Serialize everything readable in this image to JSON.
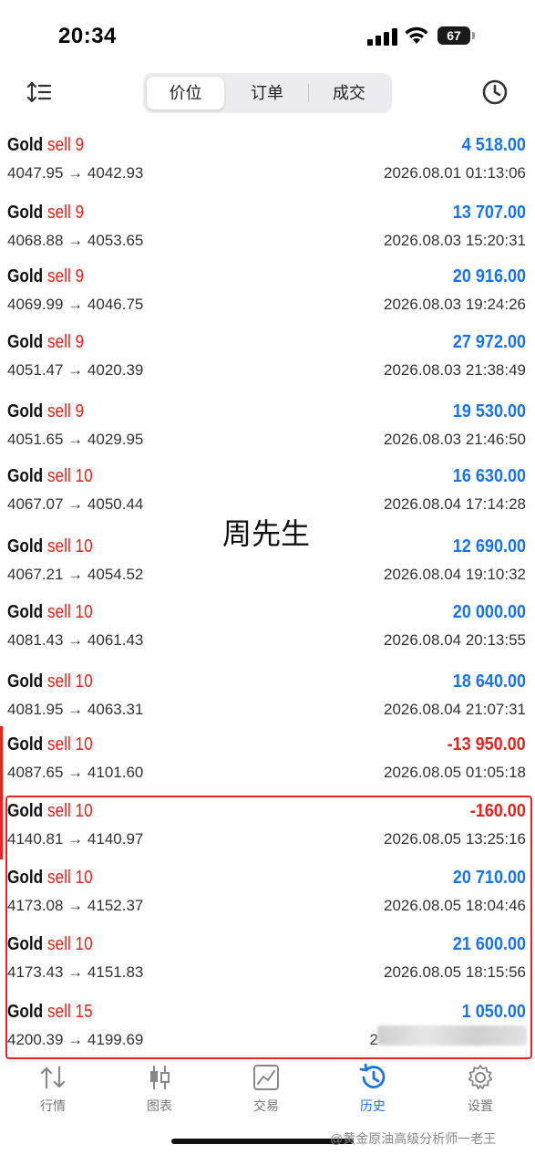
{
  "status_bar": {
    "time": "20:34",
    "battery": "67"
  },
  "toolbar": {
    "tabs": [
      {
        "label": "价位",
        "active": true
      },
      {
        "label": "订单",
        "active": false
      },
      {
        "label": "成交",
        "active": false
      }
    ]
  },
  "trades": [
    {
      "symbol": "Gold",
      "side": "sell",
      "volume": "9",
      "open": "4047.95",
      "close": "4042.93",
      "profit": "4 518.00",
      "time": "2026.08.01 01:13:06"
    },
    {
      "symbol": "Gold",
      "side": "sell",
      "volume": "9",
      "open": "4068.88",
      "close": "4053.65",
      "profit": "13 707.00",
      "time": "2026.08.03 15:20:31"
    },
    {
      "symbol": "Gold",
      "side": "sell",
      "volume": "9",
      "open": "4069.99",
      "close": "4046.75",
      "profit": "20 916.00",
      "time": "2026.08.03 19:24:26"
    },
    {
      "symbol": "Gold",
      "side": "sell",
      "volume": "9",
      "open": "4051.47",
      "close": "4020.39",
      "profit": "27 972.00",
      "time": "2026.08.03 21:38:49"
    },
    {
      "symbol": "Gold",
      "side": "sell",
      "volume": "9",
      "open": "4051.65",
      "close": "4029.95",
      "profit": "19 530.00",
      "time": "2026.08.03 21:46:50"
    },
    {
      "symbol": "Gold",
      "side": "sell",
      "volume": "10",
      "open": "4067.07",
      "close": "4050.44",
      "profit": "16 630.00",
      "time": "2026.08.04 17:14:28"
    },
    {
      "symbol": "Gold",
      "side": "sell",
      "volume": "10",
      "open": "4067.21",
      "close": "4054.52",
      "profit": "12 690.00",
      "time": "2026.08.04 19:10:32"
    },
    {
      "symbol": "Gold",
      "side": "sell",
      "volume": "10",
      "open": "4081.43",
      "close": "4061.43",
      "profit": "20 000.00",
      "time": "2026.08.04 20:13:55"
    },
    {
      "symbol": "Gold",
      "side": "sell",
      "volume": "10",
      "open": "4081.95",
      "close": "4063.31",
      "profit": "18 640.00",
      "time": "2026.08.04 21:07:31"
    },
    {
      "symbol": "Gold",
      "side": "sell",
      "volume": "10",
      "open": "4087.65",
      "close": "4101.60",
      "profit": "-13 950.00",
      "time": "2026.08.05 01:05:18"
    },
    {
      "symbol": "Gold",
      "side": "sell",
      "volume": "10",
      "open": "4140.81",
      "close": "4140.97",
      "profit": "-160.00",
      "time": "2026.08.05 13:25:16"
    },
    {
      "symbol": "Gold",
      "side": "sell",
      "volume": "10",
      "open": "4173.08",
      "close": "4152.37",
      "profit": "20 710.00",
      "time": "2026.08.05 18:04:46"
    },
    {
      "symbol": "Gold",
      "side": "sell",
      "volume": "10",
      "open": "4173.43",
      "close": "4151.83",
      "profit": "21 600.00",
      "time": "2026.08.05 18:15:56"
    },
    {
      "symbol": "Gold",
      "side": "sell",
      "volume": "15",
      "open": "4200.39",
      "close": "4199.69",
      "profit": "1 050.00",
      "time": "2"
    }
  ],
  "watermark": "周先生",
  "tabbar": {
    "items": [
      {
        "label": "行情",
        "icon": "arrows-updown-icon"
      },
      {
        "label": "图表",
        "icon": "candlestick-icon"
      },
      {
        "label": "交易",
        "icon": "trade-chart-icon"
      },
      {
        "label": "历史",
        "icon": "history-icon",
        "active": true
      },
      {
        "label": "设置",
        "icon": "gear-icon"
      }
    ]
  },
  "credit": "@黄金原油高级分析师一老王",
  "colors": {
    "accent": "#1a73e8",
    "loss": "#e0261f",
    "sell": "#e0261f"
  }
}
